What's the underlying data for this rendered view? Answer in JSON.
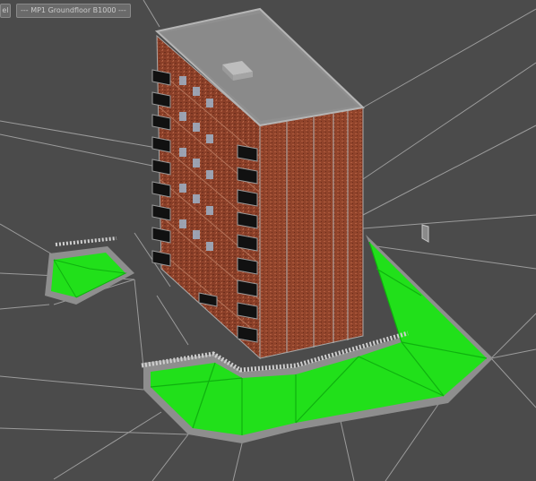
{
  "viewport": {
    "tabs": [
      {
        "label": "el"
      },
      {
        "label": "--- MP1 Groundfloor B1000 ---"
      }
    ],
    "colors": {
      "background": "#4b4b4b",
      "grid_lines": "#a9a9a9",
      "brick": "#8a3f28",
      "brick_light": "#a8553a",
      "roof": "#8f8f8f",
      "ground_green": "#21e01a",
      "ground_green_dark": "#0fb10f",
      "curb": "#8e8e8e",
      "balcony": "#111111"
    },
    "scene": {
      "building": "apartment-block",
      "floors": 10,
      "balconies_left_column": 10,
      "balconies_right_column": 10
    }
  }
}
